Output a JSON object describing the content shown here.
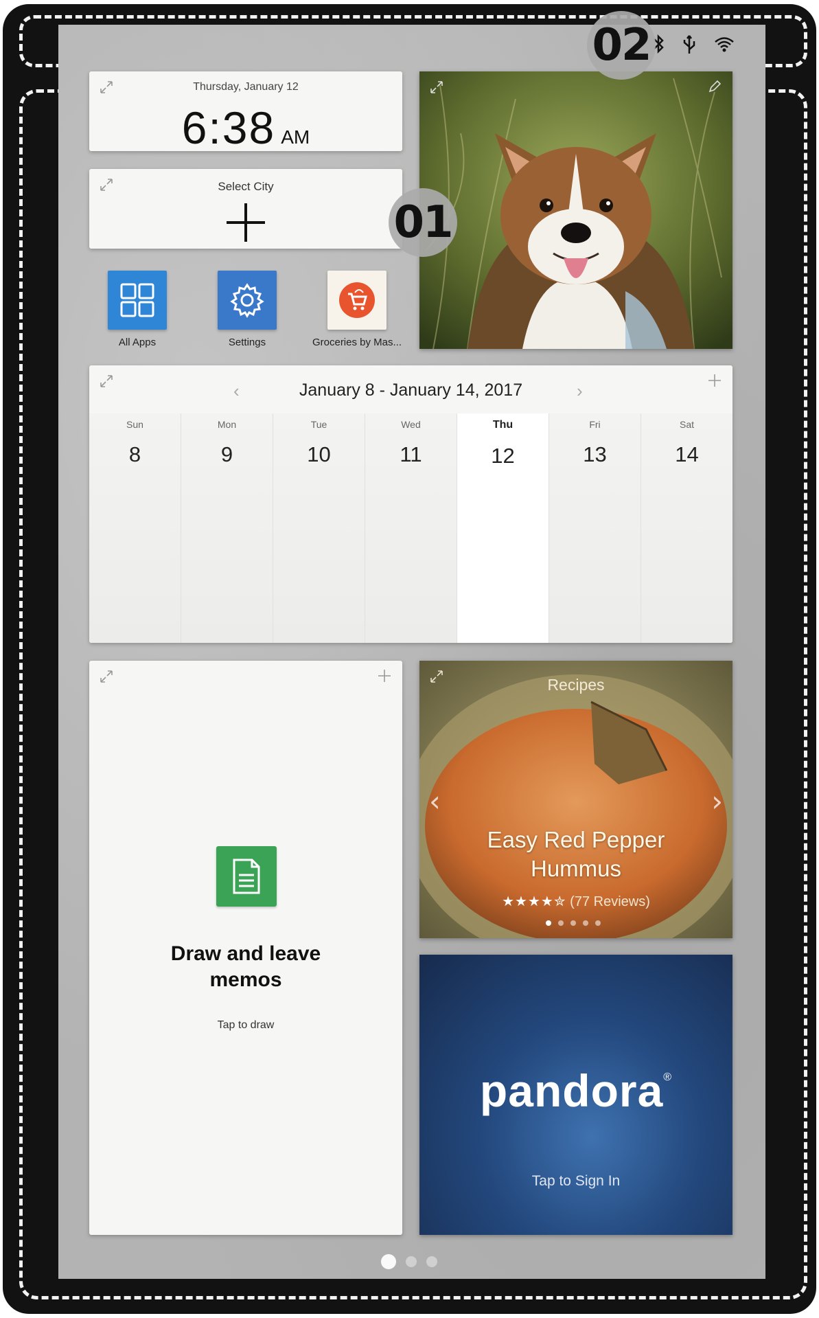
{
  "callouts": {
    "main_area": "01",
    "status_bar": "02"
  },
  "status_bar": {
    "icons": [
      "bluetooth-icon",
      "usb-icon",
      "wifi-icon"
    ]
  },
  "clock": {
    "date": "Thursday, January 12",
    "time": "6:38",
    "ampm": "AM"
  },
  "world_clock": {
    "label": "Select City"
  },
  "apps": [
    {
      "label": "All Apps",
      "icon": "grid-icon",
      "color": "#2f86d6"
    },
    {
      "label": "Settings",
      "icon": "gear-icon",
      "color": "#3a78c9"
    },
    {
      "label": "Groceries by Mas...",
      "icon": "cart-icon",
      "color": "#e8542d"
    }
  ],
  "calendar": {
    "title": "January 8 - January 14, 2017",
    "days": [
      {
        "name": "Sun",
        "num": "8"
      },
      {
        "name": "Mon",
        "num": "9"
      },
      {
        "name": "Tue",
        "num": "10"
      },
      {
        "name": "Wed",
        "num": "11"
      },
      {
        "name": "Thu",
        "num": "12",
        "today": true
      },
      {
        "name": "Fri",
        "num": "13"
      },
      {
        "name": "Sat",
        "num": "14"
      }
    ]
  },
  "memo": {
    "title": "Draw and leave memos",
    "subtitle": "Tap to draw"
  },
  "recipes": {
    "label": "Recipes",
    "name": "Easy Red Pepper Hummus",
    "stars": "★★★★✮",
    "reviews": "(77 Reviews)",
    "page_count": 5,
    "active_page": 0
  },
  "pandora": {
    "logo": "pandora",
    "trademark": "®",
    "subtitle": "Tap to Sign In"
  },
  "home_pages": {
    "count": 3,
    "active": 0
  }
}
